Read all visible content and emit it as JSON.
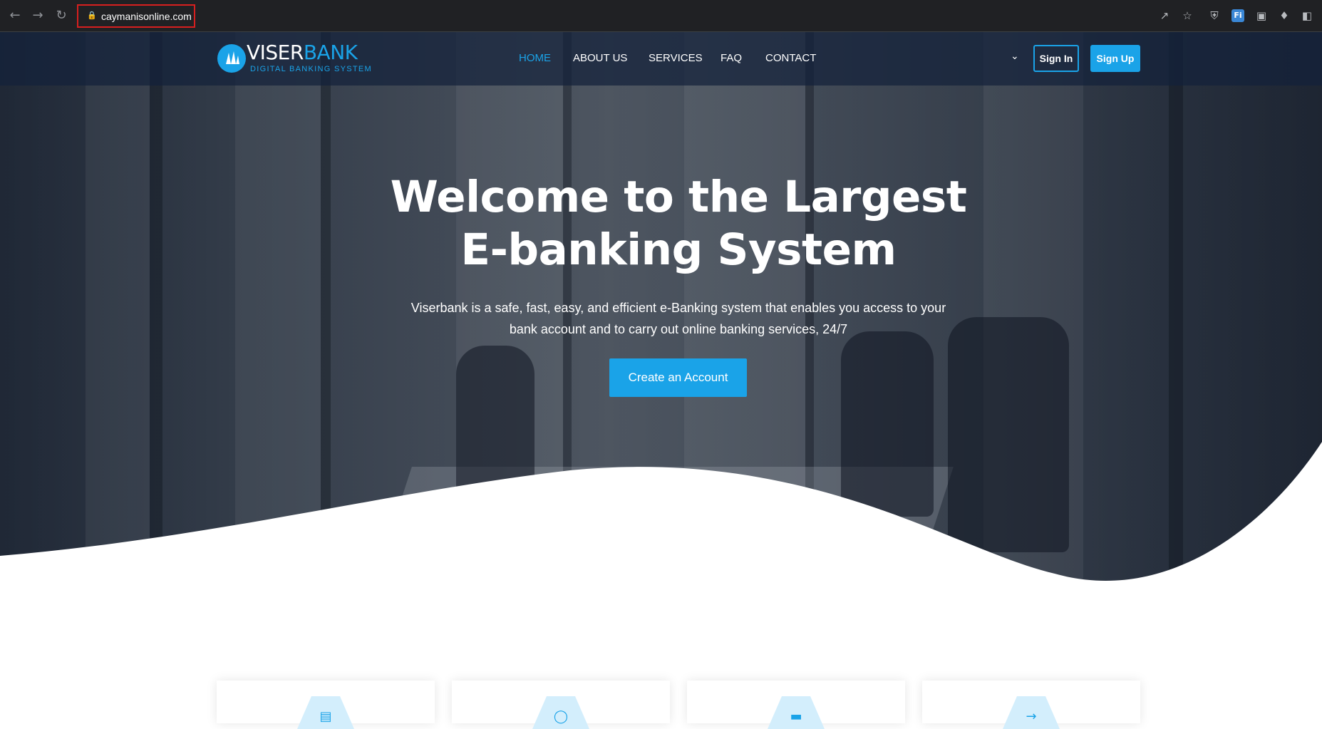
{
  "browser": {
    "url": "caymanisonline.com",
    "nav_icons": [
      "back-icon",
      "forward-icon",
      "reload-icon"
    ],
    "extension_icons": [
      "share-icon",
      "star-icon",
      "shield-icon",
      "fi-extension-icon",
      "window-icon",
      "puzzle-icon",
      "sidebar-icon"
    ],
    "fi_label": "Fi"
  },
  "site": {
    "brand": {
      "name_part1": "VISER",
      "name_part2": "BANK",
      "tagline": "DIGITAL BANKING SYSTEM"
    },
    "menu": [
      {
        "label": "HOME",
        "active": true
      },
      {
        "label": "ABOUT US",
        "active": false
      },
      {
        "label": "SERVICES",
        "active": false
      },
      {
        "label": "FAQ",
        "active": false
      },
      {
        "label": "CONTACT",
        "active": false
      }
    ],
    "sign_in": "Sign In",
    "sign_up": "Sign Up"
  },
  "hero": {
    "title_line1": "Welcome to the Largest",
    "title_line2": "E-banking System",
    "description": "Viserbank is a safe, fast, easy, and efficient e-Banking system that enables you access to your bank account and to carry out online banking services, 24/7",
    "cta": "Create an Account"
  },
  "colors": {
    "accent": "#1aa3e8",
    "nav_bg": "#14213a",
    "browser_bg": "#202124",
    "highlight_border": "#d71f1f"
  },
  "cards": [
    {
      "icon": "document-icon"
    },
    {
      "icon": "database-icon"
    },
    {
      "icon": "card-icon"
    },
    {
      "icon": "transfer-icon"
    }
  ]
}
